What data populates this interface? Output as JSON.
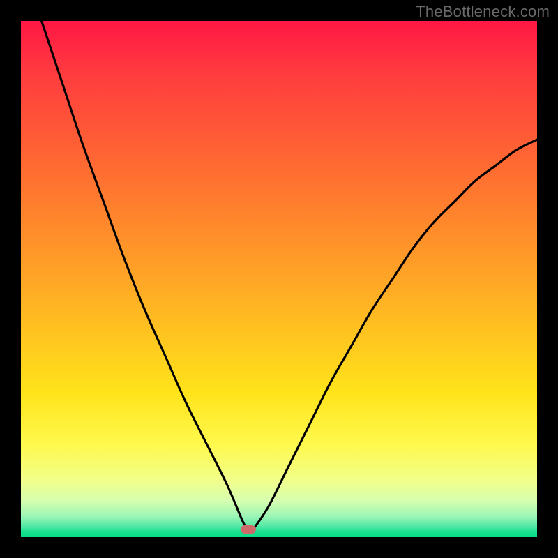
{
  "watermark": {
    "text": "TheBottleneck.com"
  },
  "colors": {
    "frame": "#000000",
    "curve": "#000000",
    "marker": "#cf6a6a",
    "gradient_top": "#ff1744",
    "gradient_bottom": "#0bdc89"
  },
  "chart_data": {
    "type": "line",
    "title": "",
    "xlabel": "",
    "ylabel": "",
    "xlim": [
      0,
      100
    ],
    "ylim": [
      0,
      100
    ],
    "grid": false,
    "legend": false,
    "annotations": [
      {
        "name": "optimal-marker",
        "x": 44,
        "y": 1.5,
        "shape": "pill",
        "color": "#cf6a6a"
      }
    ],
    "series": [
      {
        "name": "left-branch",
        "x": [
          4,
          8,
          12,
          16,
          20,
          24,
          28,
          32,
          36,
          40,
          43,
          44
        ],
        "y": [
          100,
          88,
          76,
          65,
          54,
          44,
          35,
          26,
          18,
          10,
          3,
          1.5
        ]
      },
      {
        "name": "right-branch",
        "x": [
          45,
          48,
          52,
          56,
          60,
          64,
          68,
          72,
          76,
          80,
          84,
          88,
          92,
          96,
          100
        ],
        "y": [
          1.5,
          6,
          14,
          22,
          30,
          37,
          44,
          50,
          56,
          61,
          65,
          69,
          72,
          75,
          77
        ]
      }
    ]
  }
}
